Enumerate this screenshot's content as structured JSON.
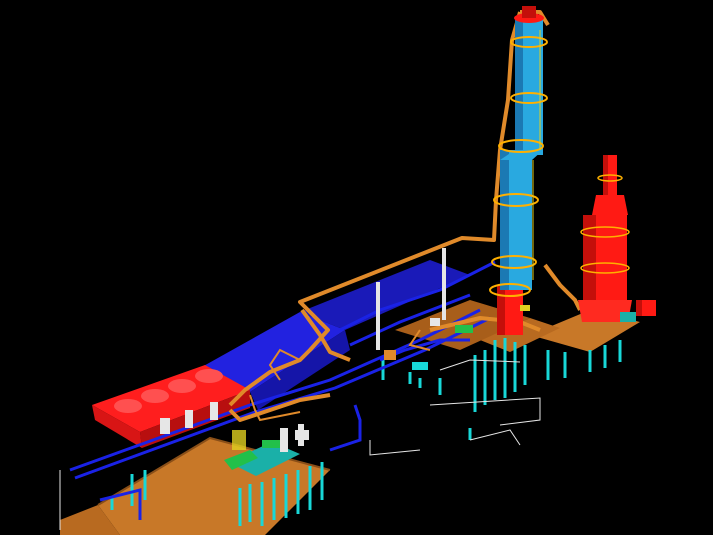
{
  "scene": {
    "colors": {
      "background": "#000000",
      "column": "#29a9e0",
      "column_shade": "#1b79b3",
      "heater": "#ff1a14",
      "heater_shade": "#c40f0a",
      "platform": "#c87828",
      "platform_edge": "#8a4f18",
      "pipe_orange": "#e08a2a",
      "pipe_blue": "#1a22e6",
      "blue_deck": "#2020d8",
      "cooler_red": "#ff1e1e",
      "support_cyan": "#18d8d8",
      "equipment_green": "#22c04a",
      "equipment_teal": "#1ab0a8",
      "structure_white": "#e6e6e6",
      "accent_yellow": "#e0d020"
    }
  }
}
